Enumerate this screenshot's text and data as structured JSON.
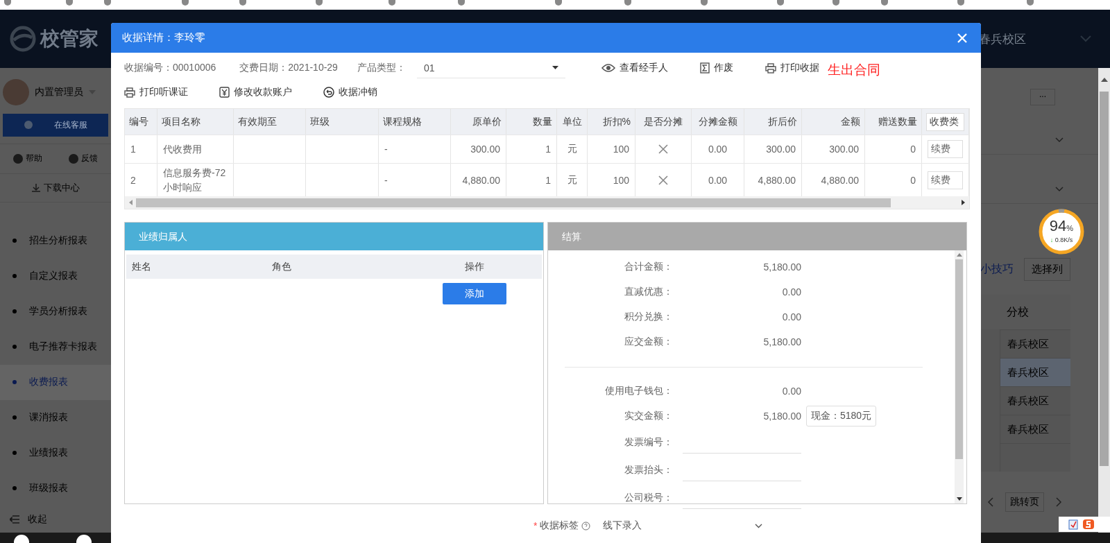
{
  "app": {
    "logo": "校管家",
    "campus": "春兵校区"
  },
  "sidebar": {
    "user": "内置管理员",
    "service": "在线客服",
    "help": "帮助",
    "feedback": "反馈",
    "download": "下载中心",
    "items": [
      {
        "label": "招生分析报表",
        "selected": false
      },
      {
        "label": "自定义报表",
        "selected": false
      },
      {
        "label": "学员分析报表",
        "selected": false
      },
      {
        "label": "电子推荐卡报表",
        "selected": false
      },
      {
        "label": "收费报表",
        "selected": true
      },
      {
        "label": "课消报表",
        "selected": false
      },
      {
        "label": "业绩报表",
        "selected": false
      },
      {
        "label": "班级报表",
        "selected": false
      }
    ],
    "collapse": "收起"
  },
  "background": {
    "more": "...",
    "tip": "小技巧",
    "select_columns": "选择列",
    "column": "分校",
    "rows": [
      "春兵校区",
      "春兵校区",
      "春兵校区",
      "春兵校区"
    ],
    "pager": "跳转页"
  },
  "dialog": {
    "title": "收据详情：李玲零",
    "info": [
      {
        "label": "收据编号：",
        "value": "00010006"
      },
      {
        "label": "交费日期：",
        "value": "2021-10-29"
      }
    ],
    "product_type": {
      "label": "产品类型：",
      "value": "01"
    },
    "actions": [
      {
        "label": "查看经手人"
      },
      {
        "label": "作废"
      },
      {
        "label": "打印收据"
      }
    ],
    "contract_link": "生出合同",
    "actions2": [
      {
        "label": "打印听课证"
      },
      {
        "label": "修改收款账户"
      },
      {
        "label": "收据冲销"
      }
    ],
    "items_table": {
      "columns": [
        "编号",
        "项目名称",
        "有效期至",
        "班级",
        "课程规格",
        "原单价",
        "数量",
        "单位",
        "折扣%",
        "是否分摊",
        "分摊金额",
        "折后价",
        "金额",
        "赠送数量",
        "收费类"
      ],
      "rows": [
        {
          "no": "1",
          "name": "代收费用",
          "valid_until": "",
          "class": "",
          "spec": "-",
          "price": "300.00",
          "qty": "1",
          "unit": "元",
          "discount": "100",
          "shared": false,
          "shared_amount": "0.00",
          "discounted": "300.00",
          "amount": "300.00",
          "gift_qty": "0",
          "fee_type": "续费"
        },
        {
          "no": "2",
          "name": "信息服务费-72小时响应",
          "valid_until": "",
          "class": "",
          "spec": "-",
          "price": "4,880.00",
          "qty": "1",
          "unit": "元",
          "discount": "100",
          "shared": false,
          "shared_amount": "0.00",
          "discounted": "4,880.00",
          "amount": "4,880.00",
          "gift_qty": "0",
          "fee_type": "续费"
        }
      ]
    },
    "performance": {
      "title": "业绩归属人",
      "columns": [
        "姓名",
        "角色",
        "操作"
      ],
      "add_button": "添加"
    },
    "settlement": {
      "title": "结算",
      "summary": [
        {
          "label": "合计金额：",
          "value": "5,180.00"
        },
        {
          "label": "直减优惠：",
          "value": "0.00"
        },
        {
          "label": "积分兑换：",
          "value": "0.00"
        },
        {
          "label": "应交金额：",
          "value": "5,180.00"
        }
      ],
      "payment": [
        {
          "kind": "value",
          "label": "使用电子钱包：",
          "value": "0.00"
        },
        {
          "kind": "value",
          "label": "实交金额：",
          "value": "5,180.00",
          "tooltip": "现金：5180元"
        },
        {
          "kind": "field",
          "label": "发票编号："
        },
        {
          "kind": "field",
          "label": "发票抬头："
        },
        {
          "kind": "field",
          "label": "公司税号："
        }
      ]
    },
    "receipt_tag": {
      "required_mark": "*",
      "label": "收据标签",
      "value": "线下录入"
    }
  },
  "speed_widget": {
    "percent": "94",
    "unit": "%",
    "arrow": "↓",
    "speed": "0.8K/s"
  }
}
